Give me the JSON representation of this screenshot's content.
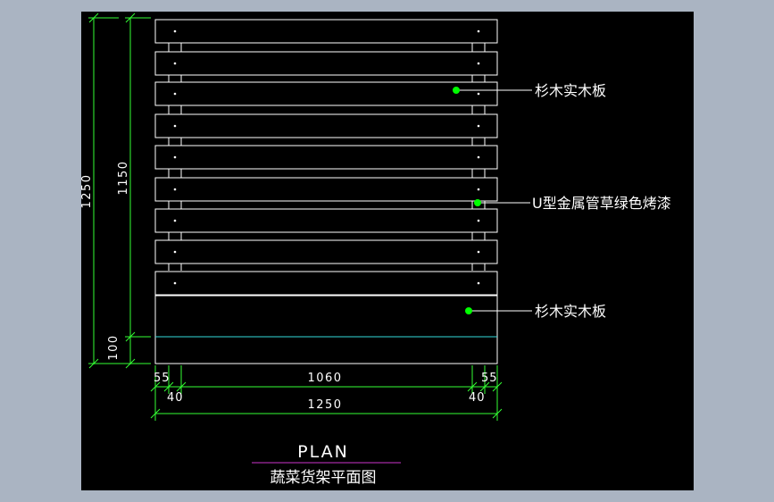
{
  "colors": {
    "background": "#aab4c2",
    "canvas": "#000000",
    "board_line": "#ffffff",
    "dimension_line": "#33ff33",
    "leader_dot": "#00ff00",
    "base_line": "#33dddd",
    "title_underline": "#cc33cc"
  },
  "dimensions": {
    "left_total": "1250",
    "left_upper": "1150",
    "left_base": "100",
    "bottom_left_margin": "55",
    "bottom_left_leg": "40",
    "bottom_middle": "1060",
    "bottom_right_margin": "55",
    "bottom_right_leg": "40",
    "bottom_total": "1250"
  },
  "callouts": {
    "top_board": "杉木实木板",
    "frame": "U型金属管草绿色烤漆",
    "bottom_board": "杉木实木板"
  },
  "title": {
    "main": "PLAN",
    "sub": "蔬菜货架平面图"
  }
}
